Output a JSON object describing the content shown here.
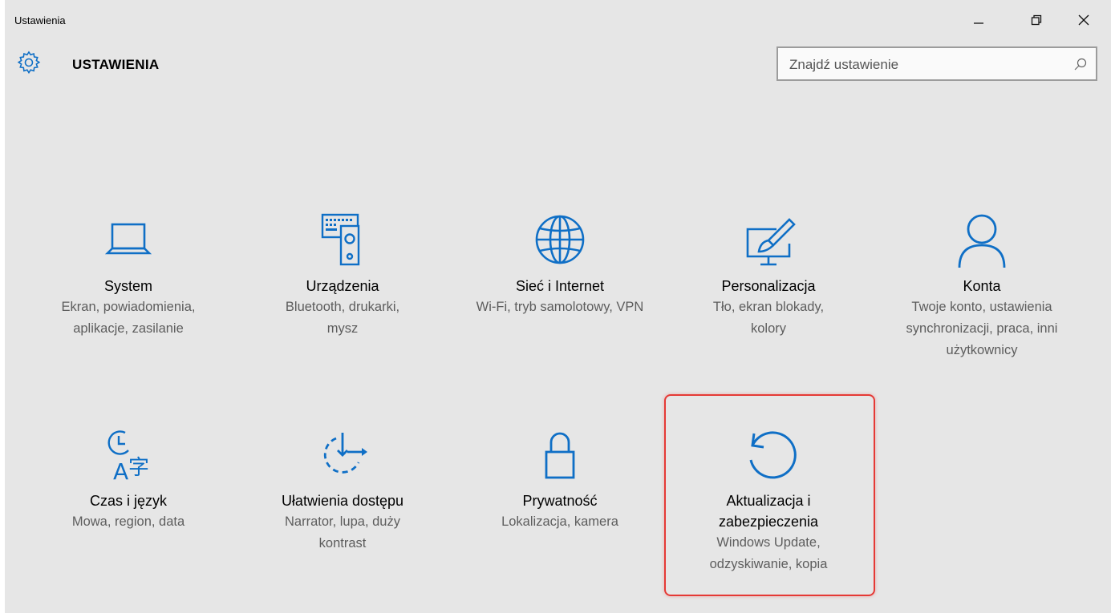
{
  "window": {
    "title": "Ustawienia"
  },
  "header": {
    "title": "USTAWIENIA",
    "icon": "gear-icon"
  },
  "search": {
    "placeholder": "Znajdź ustawienie",
    "icon": "search-icon"
  },
  "accent_color": "#0f6fc6",
  "highlight_color": "#e53935",
  "tiles": [
    {
      "icon": "laptop-icon",
      "label": "System",
      "desc": "Ekran, powiadomienia, aplikacje, zasilanie"
    },
    {
      "icon": "devices-icon",
      "label": "Urządzenia",
      "desc": "Bluetooth, drukarki, mysz"
    },
    {
      "icon": "globe-icon",
      "label": "Sieć i Internet",
      "desc": "Wi-Fi, tryb samolotowy, VPN"
    },
    {
      "icon": "personalization-icon",
      "label": "Personalizacja",
      "desc": "Tło, ekran blokady, kolory"
    },
    {
      "icon": "person-icon",
      "label": "Konta",
      "desc": "Twoje konto, ustawienia synchronizacji, praca, inni użytkownicy"
    },
    {
      "icon": "time-language-icon",
      "label": "Czas i język",
      "desc": "Mowa, region, data"
    },
    {
      "icon": "ease-of-access-icon",
      "label": "Ułatwienia dostępu",
      "desc": "Narrator, lupa, duży kontrast"
    },
    {
      "icon": "lock-icon",
      "label": "Prywatność",
      "desc": "Lokalizacja, kamera"
    },
    {
      "icon": "update-icon",
      "label": "Aktualizacja i zabezpieczenia",
      "desc": "Windows Update, odzyskiwanie, kopia",
      "highlighted": true
    }
  ]
}
